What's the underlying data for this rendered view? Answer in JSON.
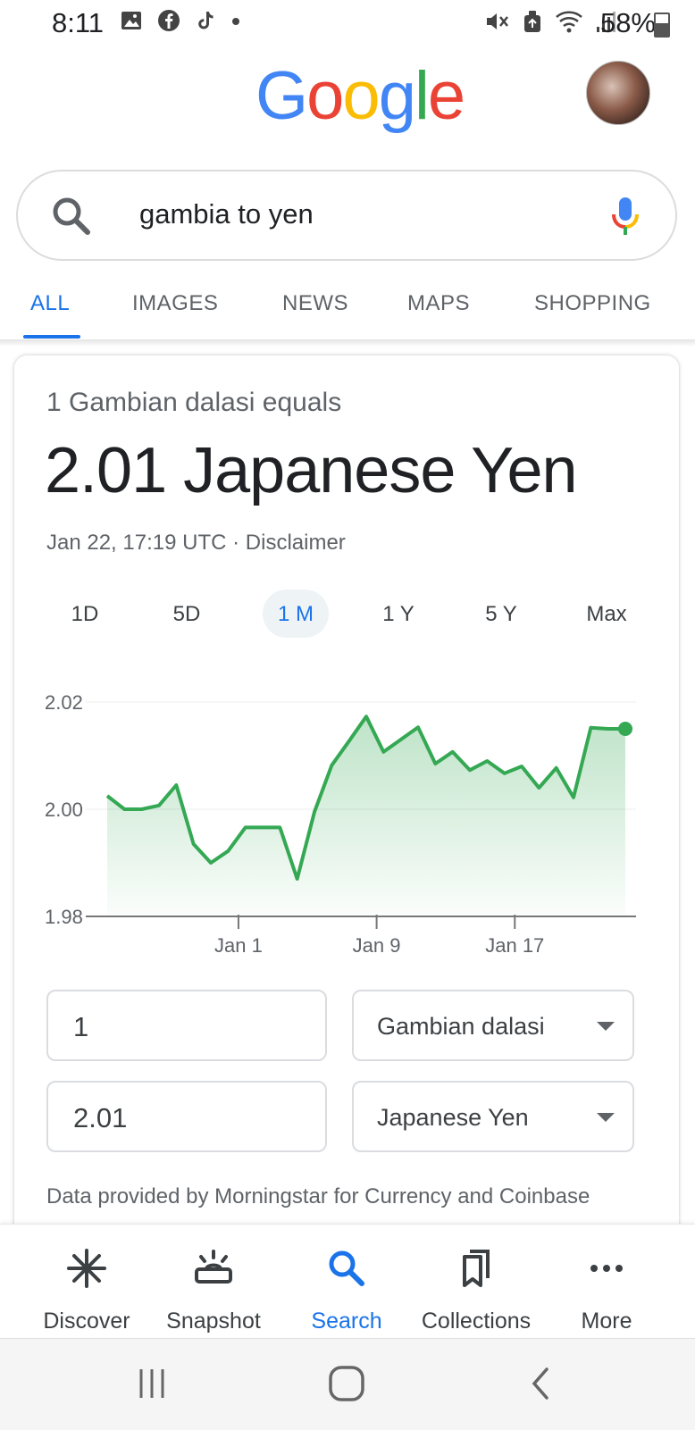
{
  "status_bar": {
    "time": "8:11",
    "battery": "58%",
    "left_icons": [
      "gallery-icon",
      "facebook-icon",
      "tiktok-icon",
      "dot-icon"
    ],
    "right_icons": [
      "mute-icon",
      "recycle-icon",
      "wifi-icon",
      "signal-icon",
      "battery-icon"
    ]
  },
  "header": {
    "logo": [
      "G",
      "o",
      "o",
      "g",
      "l",
      "e"
    ],
    "logo_colors": [
      "#4285F4",
      "#EA4335",
      "#FBBC05",
      "#4285F4",
      "#34A853",
      "#EA4335"
    ]
  },
  "search": {
    "query": "gambia to yen"
  },
  "tabs": [
    {
      "label": "ALL",
      "active": true
    },
    {
      "label": "IMAGES"
    },
    {
      "label": "NEWS"
    },
    {
      "label": "MAPS"
    },
    {
      "label": "SHOPPING"
    }
  ],
  "converter": {
    "equals_text": "1 Gambian dalasi equals",
    "result_text": "2.01 Japanese Yen",
    "updated": "Jan 22, 17:19 UTC · Disclaimer",
    "ranges": [
      "1D",
      "5D",
      "1 M",
      "1 Y",
      "5 Y",
      "Max"
    ],
    "active_range": "1 M",
    "from_amount": "1",
    "from_currency": "Gambian dalasi",
    "to_amount": "2.01",
    "to_currency": "Japanese Yen",
    "source_note": "Data provided by Morningstar for Currency and Coinbase"
  },
  "chart_data": {
    "type": "area",
    "x_tick_labels": [
      "Jan 1",
      "Jan 9",
      "Jan 17"
    ],
    "y_tick_labels": [
      "2.02",
      "2.00",
      "1.98"
    ],
    "ylim": [
      1.98,
      2.02
    ],
    "values": [
      2.0025,
      2.0,
      2.0,
      2.0007,
      2.0045,
      1.9935,
      1.99,
      1.9922,
      1.9966,
      1.9966,
      1.9966,
      1.987,
      1.9995,
      2.0082,
      2.0127,
      2.0173,
      2.0107,
      2.013,
      2.0153,
      2.0085,
      2.0107,
      2.0073,
      2.009,
      2.0067,
      2.008,
      2.004,
      2.0077,
      2.0022,
      2.0152,
      2.015,
      2.015
    ],
    "line_color": "#34a853",
    "grid": true
  },
  "bottom_nav": [
    {
      "label": "Discover",
      "icon": "asterisk-icon"
    },
    {
      "label": "Snapshot",
      "icon": "snapshot-icon"
    },
    {
      "label": "Search",
      "icon": "search-icon",
      "active": true
    },
    {
      "label": "Collections",
      "icon": "collections-icon"
    },
    {
      "label": "More",
      "icon": "more-icon"
    }
  ],
  "system_nav": [
    "recents-icon",
    "home-icon",
    "back-icon"
  ]
}
